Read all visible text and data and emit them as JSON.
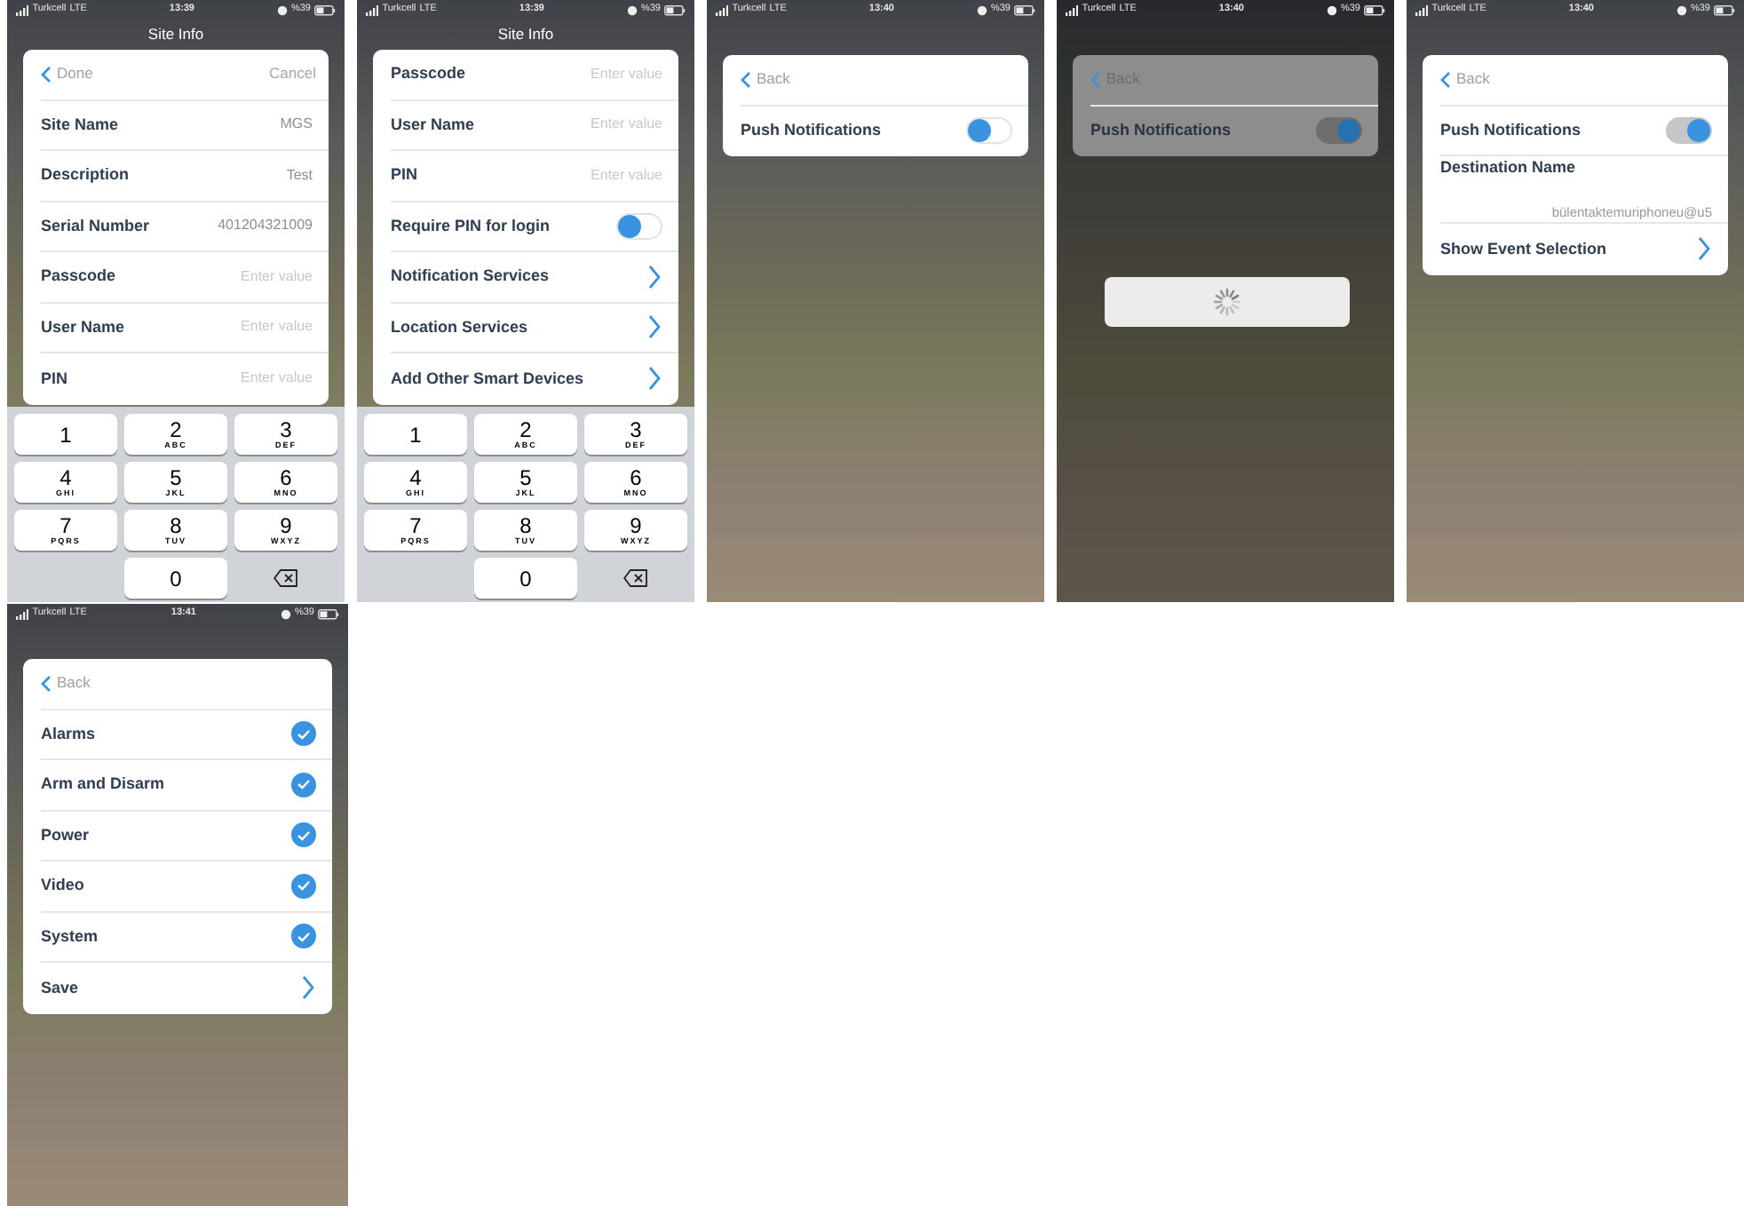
{
  "screens": [
    {
      "status": {
        "carrier": "Turkcell",
        "network": "LTE",
        "time": "13:39",
        "battery": "%39"
      },
      "title": "Site Info",
      "dimmed": false,
      "loading": false,
      "card": {
        "header": {
          "back_label": "Done",
          "action_label": "Cancel"
        },
        "rows": [
          {
            "kind": "field",
            "label": "Site Name",
            "value": "MGS"
          },
          {
            "kind": "field",
            "label": "Description",
            "value": "Test"
          },
          {
            "kind": "field",
            "label": "Serial Number",
            "value": "401204321009"
          },
          {
            "kind": "field",
            "label": "Passcode",
            "placeholder": "Enter value"
          },
          {
            "kind": "field",
            "label": "User Name",
            "placeholder": "Enter value"
          },
          {
            "kind": "field",
            "label": "PIN",
            "placeholder": "Enter value"
          }
        ]
      },
      "keypad": [
        {
          "kind": "digit",
          "digit": "1"
        },
        {
          "kind": "digit",
          "digit": "2",
          "letters": "ABC"
        },
        {
          "kind": "digit",
          "digit": "3",
          "letters": "DEF"
        },
        {
          "kind": "digit",
          "digit": "4",
          "letters": "GHI"
        },
        {
          "kind": "digit",
          "digit": "5",
          "letters": "JKL"
        },
        {
          "kind": "digit",
          "digit": "6",
          "letters": "MNO"
        },
        {
          "kind": "digit",
          "digit": "7",
          "letters": "PQRS"
        },
        {
          "kind": "digit",
          "digit": "8",
          "letters": "TUV"
        },
        {
          "kind": "digit",
          "digit": "9",
          "letters": "WXYZ"
        },
        {
          "kind": "blank"
        },
        {
          "kind": "digit",
          "digit": "0"
        },
        {
          "kind": "delete"
        }
      ]
    },
    {
      "status": {
        "carrier": "Turkcell",
        "network": "LTE",
        "time": "13:39",
        "battery": "%39"
      },
      "title": "Site Info",
      "dimmed": false,
      "loading": false,
      "card": {
        "rows": [
          {
            "kind": "field",
            "label": "Passcode",
            "placeholder": "Enter value"
          },
          {
            "kind": "field",
            "label": "User Name",
            "placeholder": "Enter value"
          },
          {
            "kind": "field",
            "label": "PIN",
            "placeholder": "Enter value"
          },
          {
            "kind": "toggle",
            "label": "Require PIN for login",
            "on": false
          },
          {
            "kind": "link",
            "label": "Notification Services"
          },
          {
            "kind": "link",
            "label": "Location Services"
          },
          {
            "kind": "link",
            "label": "Add Other Smart Devices"
          }
        ]
      },
      "keypad": [
        {
          "kind": "digit",
          "digit": "1"
        },
        {
          "kind": "digit",
          "digit": "2",
          "letters": "ABC"
        },
        {
          "kind": "digit",
          "digit": "3",
          "letters": "DEF"
        },
        {
          "kind": "digit",
          "digit": "4",
          "letters": "GHI"
        },
        {
          "kind": "digit",
          "digit": "5",
          "letters": "JKL"
        },
        {
          "kind": "digit",
          "digit": "6",
          "letters": "MNO"
        },
        {
          "kind": "digit",
          "digit": "7",
          "letters": "PQRS"
        },
        {
          "kind": "digit",
          "digit": "8",
          "letters": "TUV"
        },
        {
          "kind": "digit",
          "digit": "9",
          "letters": "WXYZ"
        },
        {
          "kind": "blank"
        },
        {
          "kind": "digit",
          "digit": "0"
        },
        {
          "kind": "delete"
        }
      ]
    },
    {
      "status": {
        "carrier": "Turkcell",
        "network": "LTE",
        "time": "13:40",
        "battery": "%39"
      },
      "dimmed": false,
      "loading": false,
      "card": {
        "header": {
          "back_label": "Back"
        },
        "rows": [
          {
            "kind": "toggle",
            "label": "Push Notifications",
            "on": false
          }
        ]
      }
    },
    {
      "status": {
        "carrier": "Turkcell",
        "network": "LTE",
        "time": "13:40",
        "battery": "%39"
      },
      "dimmed": true,
      "loading": true,
      "card": {
        "header": {
          "back_label": "Back"
        },
        "rows": [
          {
            "kind": "toggle",
            "label": "Push Notifications",
            "on": true
          }
        ]
      }
    },
    {
      "status": {
        "carrier": "Turkcell",
        "network": "LTE",
        "time": "13:40",
        "battery": "%39"
      },
      "dimmed": false,
      "loading": false,
      "card": {
        "header": {
          "back_label": "Back"
        },
        "rows": [
          {
            "kind": "toggle",
            "label": "Push Notifications",
            "on": true
          },
          {
            "kind": "detail",
            "label": "Destination Name",
            "value": "bülentaktemuriphoneu@u5"
          },
          {
            "kind": "link",
            "label": "Show Event Selection"
          }
        ]
      }
    },
    {
      "status": {
        "carrier": "Turkcell",
        "network": "LTE",
        "time": "13:41",
        "battery": "%39"
      },
      "dimmed": false,
      "loading": false,
      "card": {
        "header": {
          "back_label": "Back"
        },
        "rows": [
          {
            "kind": "check",
            "label": "Alarms",
            "checked": true
          },
          {
            "kind": "check",
            "label": "Arm and Disarm",
            "checked": true
          },
          {
            "kind": "check",
            "label": "Power",
            "checked": true
          },
          {
            "kind": "check",
            "label": "Video",
            "checked": true
          },
          {
            "kind": "check",
            "label": "System",
            "checked": true
          },
          {
            "kind": "link",
            "label": "Save"
          }
        ]
      }
    }
  ]
}
